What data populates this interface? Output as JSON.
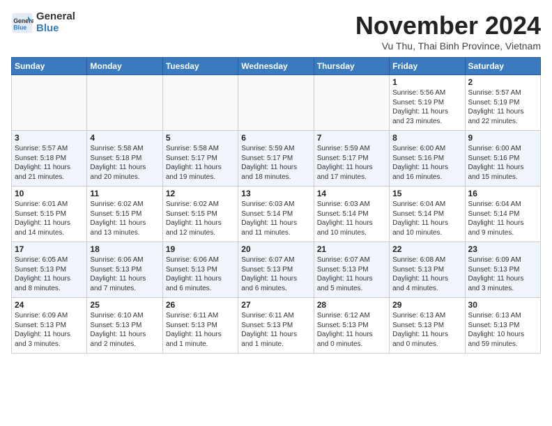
{
  "logo": {
    "general": "General",
    "blue": "Blue"
  },
  "title": "November 2024",
  "subtitle": "Vu Thu, Thai Binh Province, Vietnam",
  "weekdays": [
    "Sunday",
    "Monday",
    "Tuesday",
    "Wednesday",
    "Thursday",
    "Friday",
    "Saturday"
  ],
  "weeks": [
    [
      {
        "day": "",
        "info": ""
      },
      {
        "day": "",
        "info": ""
      },
      {
        "day": "",
        "info": ""
      },
      {
        "day": "",
        "info": ""
      },
      {
        "day": "",
        "info": ""
      },
      {
        "day": "1",
        "info": "Sunrise: 5:56 AM\nSunset: 5:19 PM\nDaylight: 11 hours\nand 23 minutes."
      },
      {
        "day": "2",
        "info": "Sunrise: 5:57 AM\nSunset: 5:19 PM\nDaylight: 11 hours\nand 22 minutes."
      }
    ],
    [
      {
        "day": "3",
        "info": "Sunrise: 5:57 AM\nSunset: 5:18 PM\nDaylight: 11 hours\nand 21 minutes."
      },
      {
        "day": "4",
        "info": "Sunrise: 5:58 AM\nSunset: 5:18 PM\nDaylight: 11 hours\nand 20 minutes."
      },
      {
        "day": "5",
        "info": "Sunrise: 5:58 AM\nSunset: 5:17 PM\nDaylight: 11 hours\nand 19 minutes."
      },
      {
        "day": "6",
        "info": "Sunrise: 5:59 AM\nSunset: 5:17 PM\nDaylight: 11 hours\nand 18 minutes."
      },
      {
        "day": "7",
        "info": "Sunrise: 5:59 AM\nSunset: 5:17 PM\nDaylight: 11 hours\nand 17 minutes."
      },
      {
        "day": "8",
        "info": "Sunrise: 6:00 AM\nSunset: 5:16 PM\nDaylight: 11 hours\nand 16 minutes."
      },
      {
        "day": "9",
        "info": "Sunrise: 6:00 AM\nSunset: 5:16 PM\nDaylight: 11 hours\nand 15 minutes."
      }
    ],
    [
      {
        "day": "10",
        "info": "Sunrise: 6:01 AM\nSunset: 5:15 PM\nDaylight: 11 hours\nand 14 minutes."
      },
      {
        "day": "11",
        "info": "Sunrise: 6:02 AM\nSunset: 5:15 PM\nDaylight: 11 hours\nand 13 minutes."
      },
      {
        "day": "12",
        "info": "Sunrise: 6:02 AM\nSunset: 5:15 PM\nDaylight: 11 hours\nand 12 minutes."
      },
      {
        "day": "13",
        "info": "Sunrise: 6:03 AM\nSunset: 5:14 PM\nDaylight: 11 hours\nand 11 minutes."
      },
      {
        "day": "14",
        "info": "Sunrise: 6:03 AM\nSunset: 5:14 PM\nDaylight: 11 hours\nand 10 minutes."
      },
      {
        "day": "15",
        "info": "Sunrise: 6:04 AM\nSunset: 5:14 PM\nDaylight: 11 hours\nand 10 minutes."
      },
      {
        "day": "16",
        "info": "Sunrise: 6:04 AM\nSunset: 5:14 PM\nDaylight: 11 hours\nand 9 minutes."
      }
    ],
    [
      {
        "day": "17",
        "info": "Sunrise: 6:05 AM\nSunset: 5:13 PM\nDaylight: 11 hours\nand 8 minutes."
      },
      {
        "day": "18",
        "info": "Sunrise: 6:06 AM\nSunset: 5:13 PM\nDaylight: 11 hours\nand 7 minutes."
      },
      {
        "day": "19",
        "info": "Sunrise: 6:06 AM\nSunset: 5:13 PM\nDaylight: 11 hours\nand 6 minutes."
      },
      {
        "day": "20",
        "info": "Sunrise: 6:07 AM\nSunset: 5:13 PM\nDaylight: 11 hours\nand 6 minutes."
      },
      {
        "day": "21",
        "info": "Sunrise: 6:07 AM\nSunset: 5:13 PM\nDaylight: 11 hours\nand 5 minutes."
      },
      {
        "day": "22",
        "info": "Sunrise: 6:08 AM\nSunset: 5:13 PM\nDaylight: 11 hours\nand 4 minutes."
      },
      {
        "day": "23",
        "info": "Sunrise: 6:09 AM\nSunset: 5:13 PM\nDaylight: 11 hours\nand 3 minutes."
      }
    ],
    [
      {
        "day": "24",
        "info": "Sunrise: 6:09 AM\nSunset: 5:13 PM\nDaylight: 11 hours\nand 3 minutes."
      },
      {
        "day": "25",
        "info": "Sunrise: 6:10 AM\nSunset: 5:13 PM\nDaylight: 11 hours\nand 2 minutes."
      },
      {
        "day": "26",
        "info": "Sunrise: 6:11 AM\nSunset: 5:13 PM\nDaylight: 11 hours\nand 1 minute."
      },
      {
        "day": "27",
        "info": "Sunrise: 6:11 AM\nSunset: 5:13 PM\nDaylight: 11 hours\nand 1 minute."
      },
      {
        "day": "28",
        "info": "Sunrise: 6:12 AM\nSunset: 5:13 PM\nDaylight: 11 hours\nand 0 minutes."
      },
      {
        "day": "29",
        "info": "Sunrise: 6:13 AM\nSunset: 5:13 PM\nDaylight: 11 hours\nand 0 minutes."
      },
      {
        "day": "30",
        "info": "Sunrise: 6:13 AM\nSunset: 5:13 PM\nDaylight: 10 hours\nand 59 minutes."
      }
    ]
  ]
}
